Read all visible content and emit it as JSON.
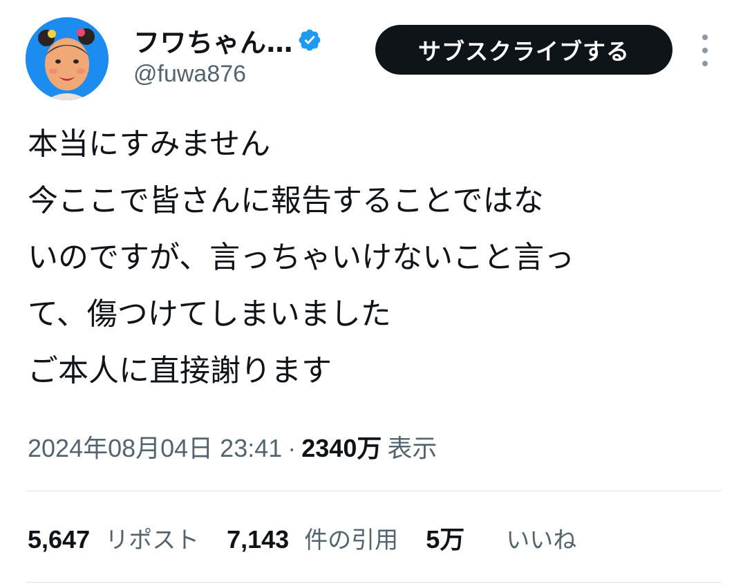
{
  "author": {
    "display_name": "フワちゃん…",
    "handle": "@fuwa876",
    "verified": true,
    "avatar_bg": "#1d8cf0"
  },
  "actions": {
    "subscribe_label": "サブスクライブする",
    "more_icon": "more-vertical-icon"
  },
  "tweet": {
    "lines": [
      "本当にすみません",
      "今ここで皆さんに報告することではな",
      "いのですが、言っちゃいけないこと言っ",
      "て、傷つけてしまいました",
      "ご本人に直接謝ります"
    ],
    "timestamp": "2024年08月04日 23:41",
    "separator": "·",
    "views_count": "2340万",
    "views_label": "表示"
  },
  "stats": {
    "reposts_count": "5,647",
    "reposts_label": "リポスト",
    "quotes_count": "7,143",
    "quotes_label": "件の引用",
    "likes_count": "5万",
    "likes_label": "いいね"
  },
  "colors": {
    "text_primary": "#0f1419",
    "text_secondary": "#536471",
    "verified_blue": "#1d9bf0",
    "button_bg": "#0f1419",
    "divider": "#dfe3e6"
  }
}
